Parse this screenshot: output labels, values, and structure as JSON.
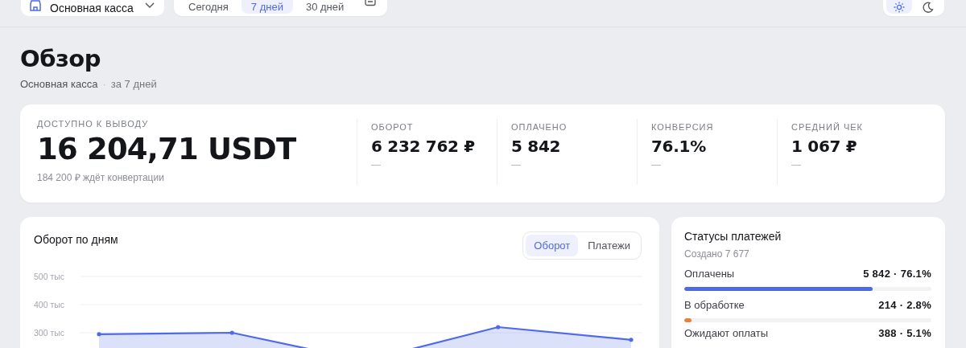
{
  "topbar": {
    "store_selector": {
      "label": "Основная касса"
    },
    "periods": [
      {
        "label": "Сегодня",
        "selected": false
      },
      {
        "label": "7 дней",
        "selected": true
      },
      {
        "label": "30 дней",
        "selected": false
      }
    ],
    "themes": [
      {
        "kind": "light",
        "selected": true
      },
      {
        "kind": "dark",
        "selected": false
      }
    ]
  },
  "header": {
    "title": "Обзор",
    "store": "Основная касса",
    "separator": "·",
    "period": "за 7 дней"
  },
  "balance": {
    "label": "ДОСТУПНО К ВЫВОДУ",
    "value": "16 204,71 USDT",
    "note": "184 200 ₽ ждёт конвертации"
  },
  "metrics": [
    {
      "label": "ОБОРОТ",
      "value": "6 232 762 ₽",
      "delta": "—"
    },
    {
      "label": "ОПЛАЧЕНО",
      "value": "5 842",
      "delta": "—"
    },
    {
      "label": "КОНВЕРСИЯ",
      "value": "76.1%",
      "delta": "—"
    },
    {
      "label": "СРЕДНИЙ ЧЕК",
      "value": "1 067 ₽",
      "delta": "—"
    }
  ],
  "turnover_chart": {
    "title": "Оборот по дням",
    "modes": [
      {
        "label": "Оборот",
        "selected": true
      },
      {
        "label": "Платежи",
        "selected": false
      }
    ],
    "chart_data": {
      "type": "area",
      "ylim": [
        0,
        500
      ],
      "yticks": [
        {
          "value": 300,
          "label": "300 тыс"
        },
        {
          "value": 400,
          "label": "400 тыс"
        },
        {
          "value": 500,
          "label": "500 тыс"
        }
      ],
      "series": [
        {
          "color": "#4f6ae8",
          "values": [
            295,
            300,
            200,
            320,
            275
          ]
        }
      ]
    }
  },
  "statuses": {
    "title": "Статусы платежей",
    "created": "Создано 7 677",
    "items": [
      {
        "label": "Оплачены",
        "value": "5 842 · 76.1%",
        "level": 0.761,
        "color": "#4f6ae8"
      },
      {
        "label": "В обработке",
        "value": "214 · 2.8%",
        "level": 0.028,
        "color": "#e8823a"
      },
      {
        "label": "Ожидают оплаты",
        "value": "388 · 5.1%"
      }
    ]
  }
}
